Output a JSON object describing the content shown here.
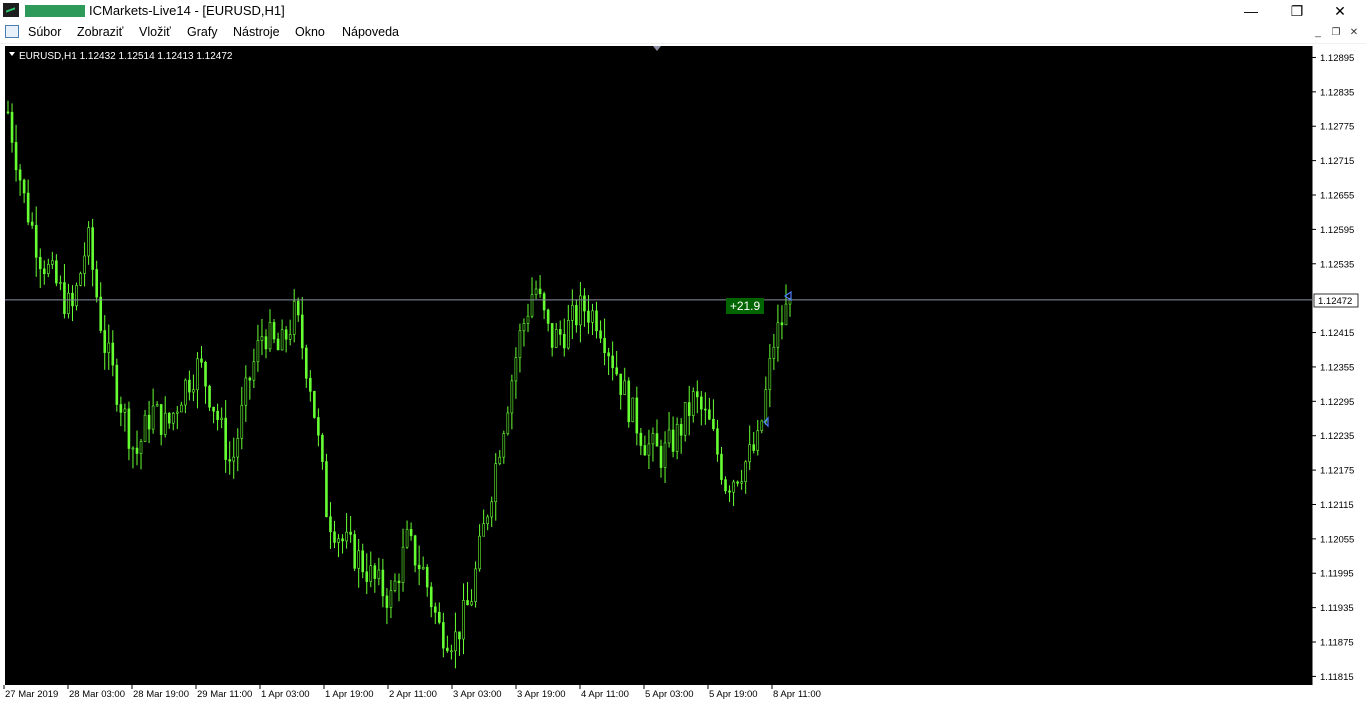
{
  "window": {
    "title": "ICMarkets-Live14 - [EURUSD,H1]",
    "minimize_icon": "minimize-icon",
    "restore_icon": "restore-icon",
    "close_icon": "close-icon"
  },
  "menu": {
    "items": [
      "Súbor",
      "Zobraziť",
      "Vložiť",
      "Grafy",
      "Nástroje",
      "Okno",
      "Nápoveda"
    ]
  },
  "chart": {
    "header": "EURUSD,H1  1.12432 1.12514 1.12413 1.12472",
    "current_price_label": "1.12472",
    "profit_label": "+21.9",
    "colors": {
      "background": "#000000",
      "candles": "#66ff33",
      "axis_text": "#000000",
      "price_line": "#8c8fa3",
      "profit_badge": "#006400"
    }
  },
  "chart_data": {
    "type": "candlestick",
    "symbol": "EURUSD",
    "timeframe": "H1",
    "ohlc_last": {
      "open": 1.12432,
      "high": 1.12514,
      "low": 1.12413,
      "close": 1.12472
    },
    "y_ticks": [
      "1.12895",
      "1.12835",
      "1.12775",
      "1.12715",
      "1.12655",
      "1.12595",
      "1.12535",
      "1.12415",
      "1.12355",
      "1.12295",
      "1.12235",
      "1.12175",
      "1.12115",
      "1.12055",
      "1.11995",
      "1.11935",
      "1.11875",
      "1.11815"
    ],
    "y_tick_values": [
      1.12895,
      1.12835,
      1.12775,
      1.12715,
      1.12655,
      1.12595,
      1.12535,
      1.12415,
      1.12355,
      1.12295,
      1.12235,
      1.12175,
      1.12115,
      1.12055,
      1.11995,
      1.11935,
      1.11875,
      1.11815
    ],
    "x_ticks": [
      "27 Mar 2019",
      "28 Mar 03:00",
      "28 Mar 19:00",
      "29 Mar 11:00",
      "1 Apr 03:00",
      "1 Apr 19:00",
      "2 Apr 11:00",
      "3 Apr 03:00",
      "3 Apr 19:00",
      "4 Apr 11:00",
      "5 Apr 03:00",
      "5 Apr 19:00",
      "8 Apr 11:00"
    ],
    "current_price": 1.12472,
    "close_path_approx": [
      1.128,
      1.1265,
      1.1255,
      1.125,
      1.1245,
      1.1258,
      1.124,
      1.123,
      1.122,
      1.1228,
      1.1225,
      1.1232,
      1.1236,
      1.1228,
      1.1218,
      1.1232,
      1.1242,
      1.1238,
      1.1245,
      1.1232,
      1.121,
      1.1205,
      1.1202,
      1.1198,
      1.1195,
      1.1205,
      1.12,
      1.119,
      1.1188,
      1.1195,
      1.121,
      1.1225,
      1.124,
      1.125,
      1.124,
      1.1242,
      1.1246,
      1.1244,
      1.1236,
      1.1228,
      1.1222,
      1.122,
      1.1224,
      1.123,
      1.1225,
      1.1215,
      1.1218,
      1.1222,
      1.124,
      1.1247
    ]
  }
}
